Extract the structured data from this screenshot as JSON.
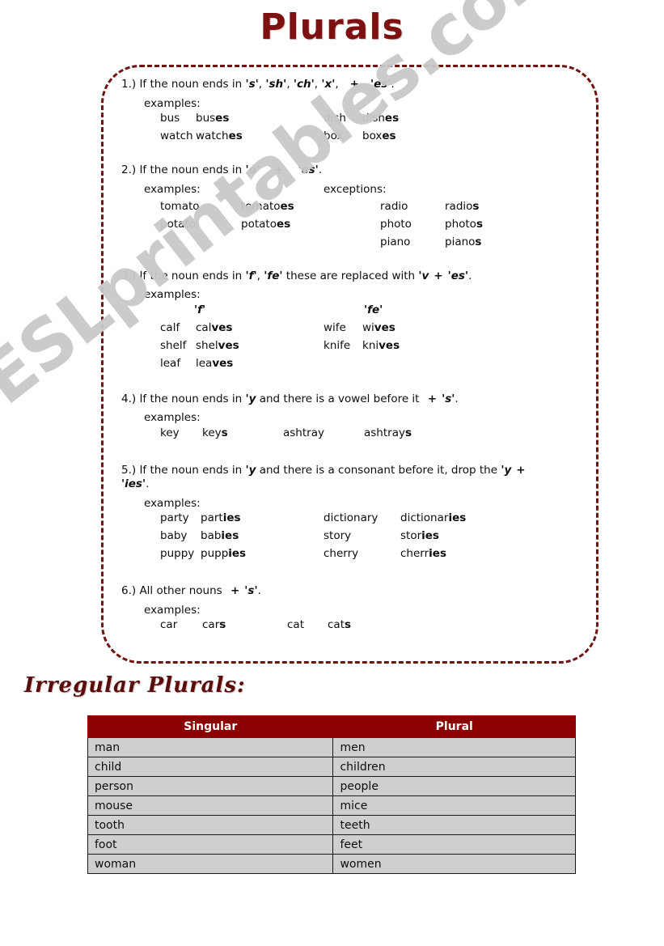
{
  "title": "Plurals",
  "watermark": "ESLprintables.com",
  "rules": [
    {
      "number": "1.)",
      "head_parts": [
        "If the noun ends in ",
        "'s'",
        ", ",
        "'sh'",
        ", ",
        "'ch'",
        ", ",
        "'x'",
        ",",
        "+",
        "'es'",
        "."
      ],
      "head_plain": "1.) If the noun ends in 's', 'sh', 'ch', 'x',   +   'es'.",
      "examples_label": "examples:",
      "columns": [],
      "rows": [
        {
          "c1": "bus",
          "c2_base": "bus",
          "c2_sfx": "es",
          "c3": "dish",
          "c4_base": "dish",
          "c4_sfx": "es"
        },
        {
          "c1": "watch",
          "c2_base": "watch",
          "c2_sfx": "es",
          "c3": "box",
          "c4_base": "box",
          "c4_sfx": "es"
        }
      ]
    },
    {
      "number": "2.)",
      "head_plain": "2.) If the noun ends in 'o'   +   'es'.",
      "examples_label": "examples:",
      "exceptions_label": "exceptions:",
      "rows": [
        {
          "c1": "tomato",
          "c2_base": "tomato",
          "c2_sfx": "es",
          "c3": "radio",
          "c4_base": "radio",
          "c4_sfx": "s"
        },
        {
          "c1": "potato",
          "c2_base": "potato",
          "c2_sfx": "es",
          "c3": "photo",
          "c4_base": "photo",
          "c4_sfx": "s"
        },
        {
          "c1": "",
          "c2_base": "",
          "c2_sfx": "",
          "c3": "piano",
          "c4_base": "piano",
          "c4_sfx": "s"
        }
      ]
    },
    {
      "number": "3.)",
      "head_plain": "3.) If the noun ends in 'f', 'fe' these are replaced with 'v + 'es'.",
      "examples_label": "examples:",
      "sub_left": "'f'",
      "sub_right": "'fe'",
      "rows": [
        {
          "c1": "calf",
          "c2_base": "cal",
          "c2_sfx": "ves",
          "c3": "wife",
          "c4_base": "wi",
          "c4_sfx": "ves"
        },
        {
          "c1": "shelf",
          "c2_base": "shel",
          "c2_sfx": "ves",
          "c3": "knife",
          "c4_base": "kni",
          "c4_sfx": "ves"
        },
        {
          "c1": "leaf",
          "c2_base": "lea",
          "c2_sfx": "ves",
          "c3": "",
          "c4_base": "",
          "c4_sfx": ""
        }
      ]
    },
    {
      "number": "4.)",
      "head_plain": "4.) If the noun ends in 'y' and there is a vowel before it + 's'.",
      "examples_label": "examples:",
      "rows": [
        {
          "c1": "key",
          "c2_base": "key",
          "c2_sfx": "s",
          "c3": "ashtray",
          "c4_base": "ashtray",
          "c4_sfx": "s"
        }
      ]
    },
    {
      "number": "5.)",
      "head_plain": "5.) If the noun ends in 'y' and there is a consonant before it, drop the 'y +",
      "head_line2": "'ies'.",
      "examples_label": "examples:",
      "rows": [
        {
          "c1": "party",
          "c2_base": "part",
          "c2_sfx": "ies",
          "c3": "dictionary",
          "c4_base": "dictionar",
          "c4_sfx": "ies"
        },
        {
          "c1": "baby",
          "c2_base": "bab",
          "c2_sfx": "ies",
          "c3": "story",
          "c4_base": "stor",
          "c4_sfx": "ies"
        },
        {
          "c1": "puppy",
          "c2_base": "pupp",
          "c2_sfx": "ies",
          "c3": "cherry",
          "c4_base": "cherr",
          "c4_sfx": "ies"
        }
      ]
    },
    {
      "number": "6.)",
      "head_plain": "6.) All other nouns  +  's'.",
      "examples_label": "examples:",
      "rows": [
        {
          "c1": "car",
          "c2_base": "car",
          "c2_sfx": "s",
          "c3": "cat",
          "c4_base": "cat",
          "c4_sfx": "s"
        }
      ]
    }
  ],
  "rule_text": {
    "r1_a": "1.) If the noun ends in ",
    "r1_s": "'s'",
    "r1_sep1": ", ",
    "r1_sh": "'sh'",
    "r1_sep2": ", ",
    "r1_ch": "'ch'",
    "r1_sep3": ", ",
    "r1_x": "'x'",
    "r1_sep4": ",",
    "r1_plus": "+",
    "r1_es": "'es'",
    "r1_end": ".",
    "r2_a": "2.) If the noun ends in ",
    "r2_o": "'o'",
    "r2_plus": "+",
    "r2_es": "'es'",
    "r2_end": ".",
    "r3_a": "3.) If the noun ends in ",
    "r3_f": "'f'",
    "r3_sep": ", ",
    "r3_fe": "'fe'",
    "r3_b": " these are replaced with ",
    "r3_v": "'v",
    "r3_plus": "+",
    "r3_es": "'es'",
    "r3_end": ".",
    "r4_a": "4.) If the noun ends in ",
    "r4_y": "'y",
    "r4_b": " and there is a vowel before it ",
    "r4_plus": "+",
    "r4_s": "'s'",
    "r4_end": ".",
    "r5_a": "5.) If the noun ends in ",
    "r5_y": "'y",
    "r5_b": " and there is a consonant before it, drop the ",
    "r5_y2": "'y",
    "r5_plus": "+",
    "r5_ies": "'ies'",
    "r5_end": ".",
    "r6_a": "6.) All other nouns ",
    "r6_plus": "+",
    "r6_s": "'s'",
    "r6_end": "."
  },
  "labels": {
    "examples": "examples:",
    "exceptions": "exceptions:",
    "f_head": "'f'",
    "fe_head": "'fe'"
  },
  "irregular": {
    "heading": "Irregular Plurals:",
    "columns": [
      "Singular",
      "Plural"
    ],
    "rows": [
      [
        "man",
        "men"
      ],
      [
        "child",
        "children"
      ],
      [
        "person",
        "people"
      ],
      [
        "mouse",
        "mice"
      ],
      [
        "tooth",
        "teeth"
      ],
      [
        "foot",
        "feet"
      ],
      [
        "woman",
        "women"
      ]
    ]
  },
  "colors": {
    "title": "#7d1010",
    "frame_border": "#6e1414",
    "table_header_bg": "#8b0000",
    "table_row_bg": "#cfcfcf",
    "watermark": "#c9c9c9"
  }
}
